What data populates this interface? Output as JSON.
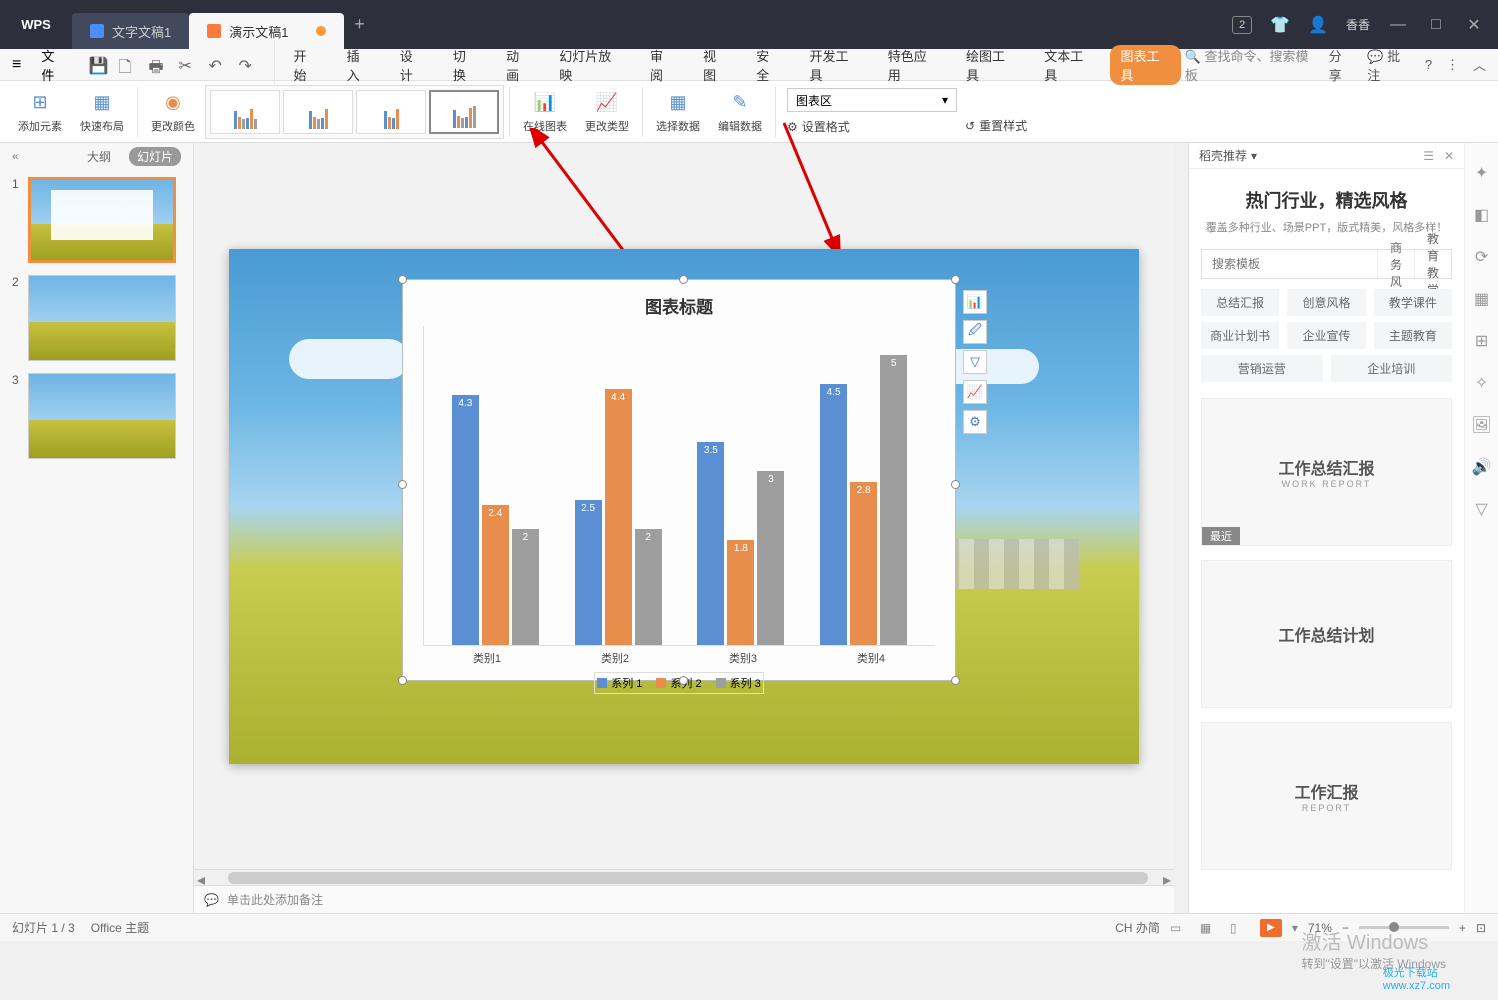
{
  "titlebar": {
    "app": "WPS",
    "tabs": [
      {
        "icon": "word",
        "label": "文字文稿1"
      },
      {
        "icon": "ppt",
        "label": "演示文稿1",
        "dirty": true
      }
    ],
    "notif_count": "2",
    "user": "香香"
  },
  "ribbon": {
    "file": "文件",
    "tabs": [
      "开始",
      "插入",
      "设计",
      "切换",
      "动画",
      "幻灯片放映",
      "审阅",
      "视图",
      "安全",
      "开发工具",
      "特色应用",
      "绘图工具",
      "文本工具",
      "图表工具"
    ],
    "search_placeholder": "查找命令、搜索模板",
    "share": "分享",
    "annotate": "批注"
  },
  "toolbar": {
    "add_element": "添加元素",
    "quick_layout": "快速布局",
    "change_colors": "更改颜色",
    "online_chart": "在线图表",
    "change_type": "更改类型",
    "select_data": "选择数据",
    "edit_data": "编辑数据",
    "chart_area_select": "图表区",
    "set_format": "设置格式",
    "reset_style": "重置样式"
  },
  "left_panel": {
    "tab_outline": "大纲",
    "tab_slides": "幻灯片",
    "slides": [
      1,
      2,
      3
    ]
  },
  "chart_data": {
    "type": "bar",
    "title": "图表标题",
    "categories": [
      "类别1",
      "类别2",
      "类别3",
      "类别4"
    ],
    "series": [
      {
        "name": "系列 1",
        "values": [
          4.3,
          2.5,
          3.5,
          4.5
        ],
        "color": "#5a8fd4"
      },
      {
        "name": "系列 2",
        "values": [
          2.4,
          4.4,
          1.8,
          2.8
        ],
        "color": "#e88e4c"
      },
      {
        "name": "系列 3",
        "values": [
          2,
          2,
          3,
          5
        ],
        "color": "#9e9e9e"
      }
    ],
    "ymax": 5
  },
  "notes": {
    "placeholder": "单击此处添加备注"
  },
  "right_panel": {
    "header": "稻壳推荐",
    "title": "热门行业，精选风格",
    "subtitle": "覆盖多种行业、场景PPT，版式精美，风格多样！",
    "search_placeholder": "搜索模板",
    "search_tabs": [
      "商务风",
      "教育教学"
    ],
    "tags": [
      [
        "总结汇报",
        "创意风格",
        "教学课件"
      ],
      [
        "商业计划书",
        "企业宣传",
        "主题教育"
      ],
      [
        "营销运营",
        "企业培训"
      ]
    ],
    "templates": [
      {
        "title": "工作总结汇报",
        "sub": "WORK REPORT",
        "badge": "最近"
      },
      {
        "title": "工作总结计划",
        "sub": ""
      },
      {
        "title": "工作汇报",
        "sub": "REPORT"
      }
    ],
    "activate": "激活 Windows",
    "activate_sub": "转到\"设置\"以激活 Windows"
  },
  "status": {
    "slide": "幻灯片 1 / 3",
    "theme": "Office 主题",
    "ime": "CH 办简",
    "zoom": "71%"
  },
  "watermark": {
    "site": "极光下载站",
    "url": "www.xz7.com"
  }
}
